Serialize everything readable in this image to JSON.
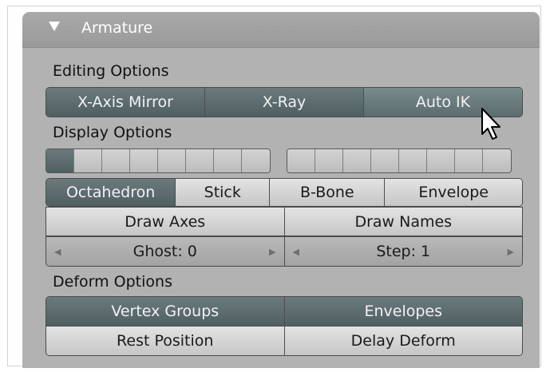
{
  "panel": {
    "title": "Armature"
  },
  "editing": {
    "label": "Editing Options",
    "buttons": [
      {
        "label": "X-Axis Mirror",
        "state": "on"
      },
      {
        "label": "X-Ray",
        "state": "on"
      },
      {
        "label": "Auto IK",
        "state": "hover"
      }
    ]
  },
  "display": {
    "label": "Display Options",
    "layer_group_1_active": [
      true,
      false,
      false,
      false,
      false,
      false,
      false,
      false
    ],
    "layer_group_2_active": [
      false,
      false,
      false,
      false,
      false,
      false,
      false,
      false
    ],
    "draw_types": [
      {
        "label": "Octahedron",
        "selected": true
      },
      {
        "label": "Stick",
        "selected": false
      },
      {
        "label": "B-Bone",
        "selected": false
      },
      {
        "label": "Envelope",
        "selected": false
      }
    ],
    "toggles": [
      "Draw Axes",
      "Draw Names"
    ],
    "ghost": "Ghost: 0",
    "step": "Step: 1"
  },
  "deform": {
    "label": "Deform Options",
    "row1": [
      "Vertex Groups",
      "Envelopes"
    ],
    "row2": [
      "Rest Position",
      "Delay Deform"
    ]
  },
  "colors": {
    "active": "#5b6b6e",
    "inactive": "#d6d6d6",
    "panel": "#b2b2b2",
    "header": "#a0a0a0"
  },
  "icons": {
    "collapse": "triangle-down-icon",
    "cursor": "mouse-pointer-icon",
    "decrement": "arrow-left-icon",
    "increment": "arrow-right-icon"
  }
}
